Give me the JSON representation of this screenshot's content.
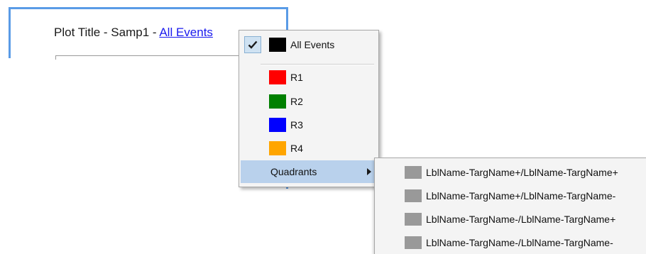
{
  "plot": {
    "title_prefix": "Plot Title - Samp1 - ",
    "title_link": "All Events"
  },
  "menu": {
    "items": [
      {
        "label": "All Events",
        "color": "#000000",
        "checked": true
      },
      {
        "label": "R1",
        "color": "#ff0000",
        "checked": false
      },
      {
        "label": "R2",
        "color": "#008000",
        "checked": false
      },
      {
        "label": "R3",
        "color": "#0000ff",
        "checked": false
      },
      {
        "label": "R4",
        "color": "#ffa500",
        "checked": false
      }
    ],
    "submenu_label": "Quadrants",
    "highlight_color": "#b9d1ec"
  },
  "submenu": {
    "items": [
      {
        "label": "LblName-TargName+/LblName-TargName+",
        "color": "#999999"
      },
      {
        "label": "LblName-TargName+/LblName-TargName-",
        "color": "#999999"
      },
      {
        "label": "LblName-TargName-/LblName-TargName+",
        "color": "#999999"
      },
      {
        "label": "LblName-TargName-/LblName-TargName-",
        "color": "#999999"
      }
    ]
  },
  "icons": {
    "check": "check-icon",
    "submenu_arrow": "chevron-right-icon"
  }
}
